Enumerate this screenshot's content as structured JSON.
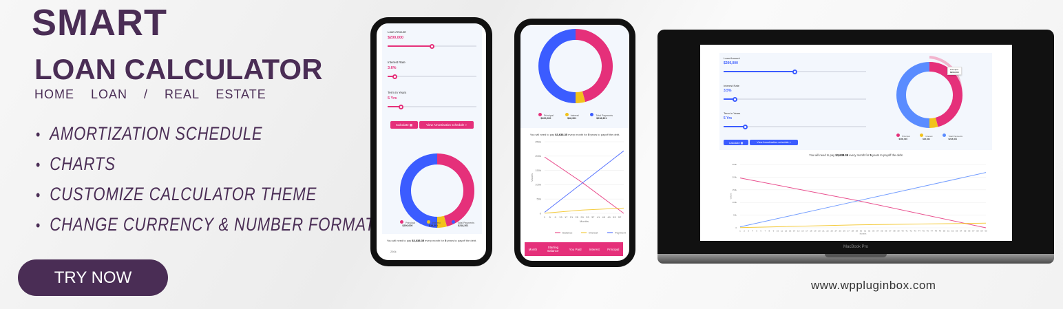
{
  "banner": {
    "title_line1": "SMART",
    "title_line2": "LOAN CALCULATOR",
    "subtitle": "HOME  LOAN  /  REAL  ESTATE",
    "features": [
      "AMORTIZATION SCHEDULE",
      "CHARTS",
      "CUSTOMIZE CALCULATOR THEME",
      "CHANGE CURRENCY & NUMBER FORMAT"
    ],
    "cta": "TRY NOW",
    "website": "www.wppluginbox.com",
    "laptop_label": "MacBook Pro"
  },
  "colors": {
    "brand": "#4a2d55",
    "pink": "#e5307a",
    "blue": "#3b5cff",
    "yellow": "#f2c21b",
    "panel": "#f3f7fd"
  },
  "calculator": {
    "loan_amount_label": "Loan Amount",
    "loan_amount": "$200,000",
    "loan_amount_fraction": 0.5,
    "interest_label": "Interest Rate",
    "interest_mobile": "3.6%",
    "interest_desktop": "3.5%",
    "interest_fraction": 0.08,
    "term_label": "Term in Years",
    "term": "5 Yrs",
    "term_fraction": 0.15,
    "calculate_label": "Calculate ▦",
    "schedule_label": "View Amortization schedule »",
    "legend": [
      {
        "label": "Principal",
        "value": "$200,000"
      },
      {
        "label": "Interest",
        "value": "$18,301"
      },
      {
        "label": "Total Payments",
        "value": "$218,301"
      }
    ],
    "tooltip": {
      "label": "Principal:",
      "value": "$200,000"
    },
    "summary_pre": "You will need to pay ",
    "summary_amount": "$3,638.35",
    "summary_mid": " every month for ",
    "summary_years": "5",
    "summary_post": " years to payoff the debt.",
    "table_headers": [
      "Month",
      "Starting Balance",
      "You Paid",
      "Interest",
      "Principal"
    ]
  },
  "chart_data": {
    "type": "line",
    "xlabel": "Months",
    "ylabel": "Values",
    "ylim": [
      0,
      250000
    ],
    "yticks": [
      "0",
      "50k",
      "100k",
      "150k",
      "200k",
      "250k"
    ],
    "xlim": [
      1,
      60
    ],
    "donut": {
      "type": "pie",
      "categories": [
        "Principal",
        "Interest",
        "Total Payments"
      ],
      "values": [
        200000,
        18301,
        218301
      ]
    },
    "series": [
      {
        "name": "Balance",
        "color": "#e5307a",
        "points": [
          [
            1,
            196700
          ],
          [
            29,
            108000
          ],
          [
            60,
            0
          ]
        ]
      },
      {
        "name": "Interest",
        "color": "#f2c21b",
        "points": [
          [
            1,
            600
          ],
          [
            29,
            11500
          ],
          [
            60,
            18301
          ]
        ]
      },
      {
        "name": "Payment",
        "color": "#3b5cff",
        "points": [
          [
            1,
            3638
          ],
          [
            29,
            105500
          ],
          [
            60,
            218301
          ]
        ]
      }
    ]
  }
}
